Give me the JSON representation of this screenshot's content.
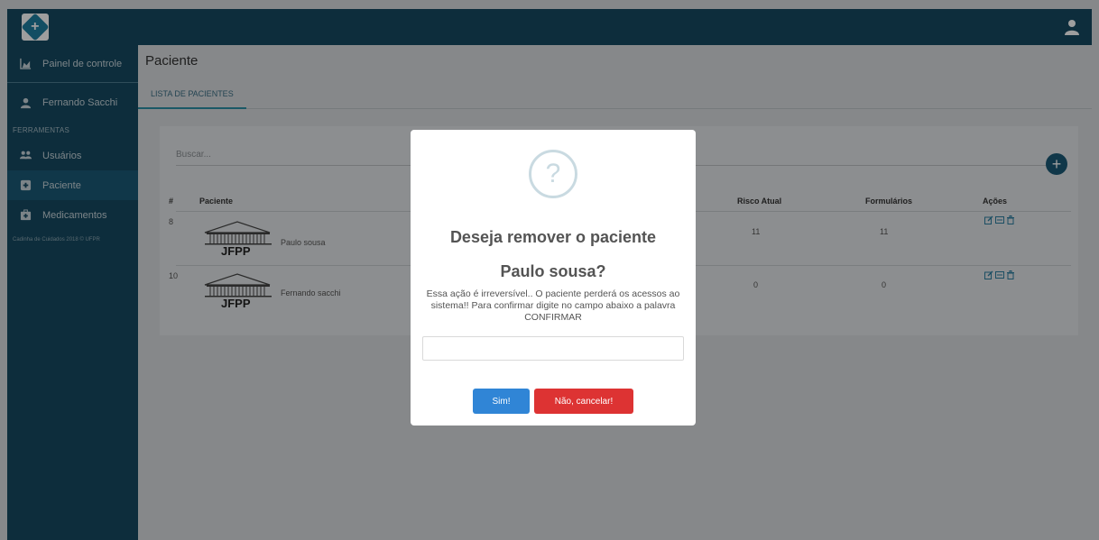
{
  "sidebar": {
    "items": [
      {
        "label": "Painel de controle",
        "icon": "area-chart-icon"
      },
      {
        "label": "Fernando Sacchi",
        "icon": "user-icon"
      },
      {
        "label": "Usuários",
        "icon": "users-icon"
      },
      {
        "label": "Paciente",
        "icon": "plus-square-icon"
      },
      {
        "label": "Medicamentos",
        "icon": "medkit-icon"
      }
    ],
    "section_label": "FERRAMENTAS",
    "footer": "Cadinha de Cuidados 2018 © UFPR"
  },
  "header": {
    "page_title": "Paciente",
    "user_icon": "user-icon"
  },
  "tabs": [
    {
      "label": "LISTA DE PACIENTES"
    }
  ],
  "search": {
    "placeholder": "Buscar..."
  },
  "table": {
    "headers": {
      "id": "#",
      "name": "Paciente",
      "risk": "Risco Atual",
      "forms": "Formulários",
      "actions": "Ações"
    },
    "rows": [
      {
        "id": "8",
        "name": "Paulo sousa",
        "risk": "11",
        "forms": "11",
        "logo_text": "JFPP"
      },
      {
        "id": "10",
        "name": "Fernando sacchi",
        "risk": "0",
        "forms": "0",
        "logo_text": "JFPP"
      }
    ]
  },
  "modal": {
    "icon_symbol": "?",
    "title_line1": "Deseja remover o paciente",
    "title_line2": "Paulo sousa?",
    "text": "Essa ação é irreversível.. O paciente perderá os acessos ao sistema!! Para confirmar digite no campo abaixo a palavra CONFIRMAR",
    "input_value": "",
    "confirm_label": "Sim!",
    "cancel_label": "Não, cancelar!"
  },
  "colors": {
    "primary": "#154a62",
    "confirm": "#3085d6",
    "cancel": "#dd3333"
  }
}
